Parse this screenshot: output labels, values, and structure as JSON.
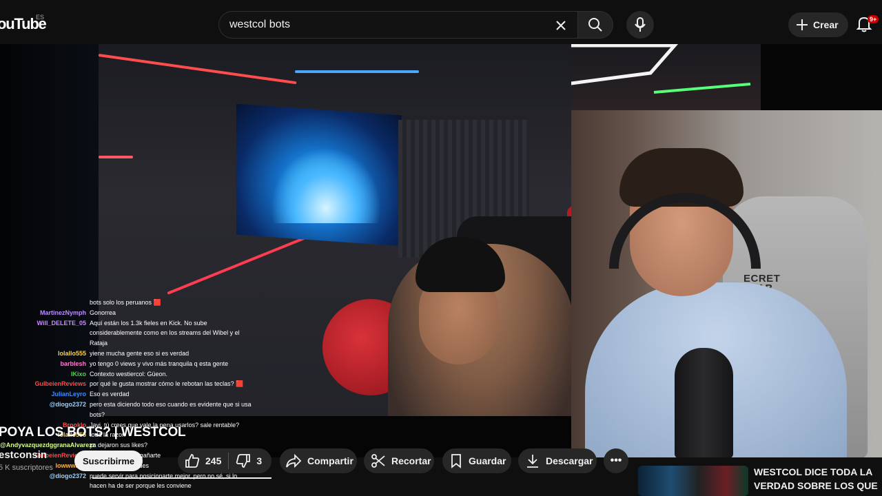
{
  "header": {
    "logo": "ouTube",
    "country": "ES",
    "search_value": "westcol bots",
    "create_label": "Crear",
    "notifications": "9+"
  },
  "video": {
    "cam_brand": "ECRET\nLAB"
  },
  "chat": [
    {
      "user": "",
      "msg": "bots solo los peruanos 🟥",
      "color": "#ffffff"
    },
    {
      "user": "MartinezNymph",
      "msg": "Gonorrea",
      "color": "#b98cff"
    },
    {
      "user": "Will_DELETE_05",
      "msg": "Aquí están los 1.3k fieles en Kick. No sube considerablemente como en los streams del Wibel y el Rataja",
      "color": "#c58bff"
    },
    {
      "user": "lolallo555",
      "msg": "yiene mucha gente eso si es verdad",
      "color": "#ffd23b"
    },
    {
      "user": "barblesh",
      "msg": "yo tengo 0 views y vivo más tranquila q esta gente",
      "color": "#ff7bd1"
    },
    {
      "user": "IKixo",
      "msg": "Contexto westiercol: Güeon.",
      "color": "#55d34f"
    },
    {
      "user": "GulbeienReviews",
      "msg": "por qué le gusta mostrar cómo le rebotan las teclas? 🟥",
      "color": "#ff4a4a"
    },
    {
      "user": "JulianLeyro",
      "msg": "Eso es verdad",
      "color": "#3f8cff"
    },
    {
      "user": "@diogo2372",
      "msg": "pero esta diciendo todo eso cuando es evidente que si usa bots?",
      "color": "#9ad1ff"
    },
    {
      "user": "Brooklo",
      "msg": "Javi, tú crees que vale la pena usarlos? sale rentable?",
      "color": "#ff5050"
    },
    {
      "user": "lolallo555",
      "msg": "toda la razon",
      "color": "#ffd23b"
    },
    {
      "user": "@AndyvazquezdggranaAlvarezz",
      "msg": "ya dejaron sus likes?",
      "color": "#d7ff8a"
    },
    {
      "user": "GulbeienReviews",
      "msg": "no sé para qué engañarte",
      "color": "#ff4a4a"
    },
    {
      "user": "lowwwayo",
      "msg": "esos bots de grandes",
      "color": "#ffb347"
    },
    {
      "user": "@diogo2372",
      "msg": "puede servir para posicionarte mejor, pero no sé, si lo hacen ha de ser porque les conviene",
      "color": "#9ad1ff"
    }
  ],
  "meta": {
    "title": "POYA LOS BOTS? | WESTCOL",
    "channel": "estconsin",
    "subscribers": "5 K suscriptores",
    "subscribe_label": "Suscribirme"
  },
  "actions": {
    "likes": "245",
    "dislikes": "3",
    "share": "Compartir",
    "clip": "Recortar",
    "save": "Guardar",
    "download": "Descargar",
    "more": "•••"
  },
  "recommendation": {
    "title": "WESTCOL DICE TODA LA VERDAD SOBRE LOS QUE USA..."
  }
}
